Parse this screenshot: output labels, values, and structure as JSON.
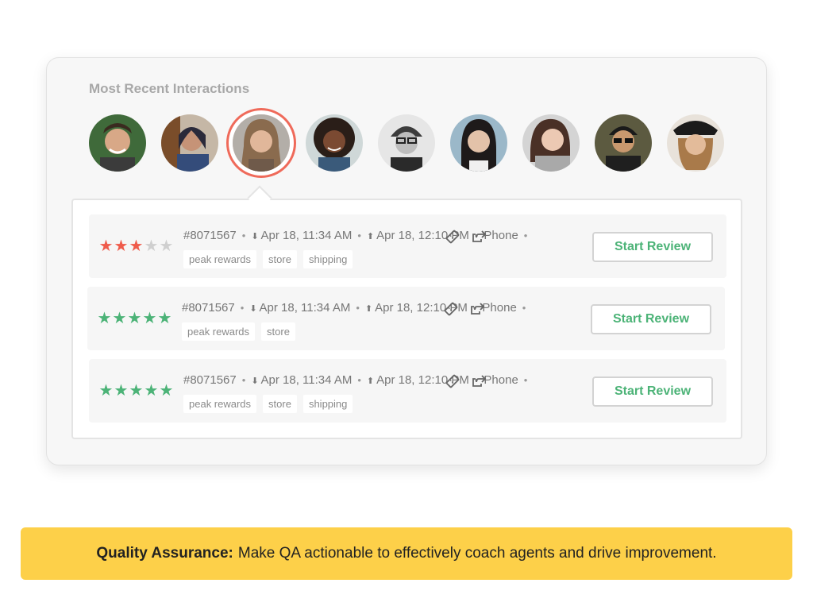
{
  "section_title": "Most Recent Interactions",
  "colors": {
    "star_active_red": "#ef5b4b",
    "star_active_green": "#4cb377",
    "star_inactive": "#cfcfcf",
    "selected_ring": "#ef6a5a",
    "button_text": "#4cb377",
    "banner_bg": "#fdd049"
  },
  "avatars": [
    {
      "name": "avatar-1"
    },
    {
      "name": "avatar-2"
    },
    {
      "name": "avatar-3",
      "selected": true
    },
    {
      "name": "avatar-4"
    },
    {
      "name": "avatar-5"
    },
    {
      "name": "avatar-6"
    },
    {
      "name": "avatar-7"
    },
    {
      "name": "avatar-8"
    },
    {
      "name": "avatar-9"
    }
  ],
  "interactions": [
    {
      "rating": 3,
      "max_rating": 5,
      "star_color": "red",
      "id": "#8071567",
      "received": "Apr 18, 11:34 AM",
      "sent": "Apr 18, 12:10 PM",
      "channel": "Phone",
      "tags": [
        "peak rewards",
        "store",
        "shipping"
      ],
      "button": "Start Review"
    },
    {
      "rating": 5,
      "max_rating": 5,
      "star_color": "green",
      "id": "#8071567",
      "received": "Apr 18, 11:34 AM",
      "sent": "Apr 18, 12:10 PM",
      "channel": "Phone",
      "tags": [
        "peak rewards",
        "store"
      ],
      "button": "Start Review"
    },
    {
      "rating": 5,
      "max_rating": 5,
      "star_color": "green",
      "id": "#8071567",
      "received": "Apr 18, 11:34 AM",
      "sent": "Apr 18, 12:10 PM",
      "channel": "Phone",
      "tags": [
        "peak rewards",
        "store",
        "shipping"
      ],
      "button": "Start Review"
    }
  ],
  "icons": {
    "ticket": "ticket-icon",
    "share": "share-icon",
    "down": "arrow-down-icon",
    "up": "arrow-up-icon",
    "star": "star-icon"
  },
  "banner": {
    "bold": "Quality Assurance:",
    "text": "Make QA actionable to effectively coach agents and drive improvement."
  }
}
